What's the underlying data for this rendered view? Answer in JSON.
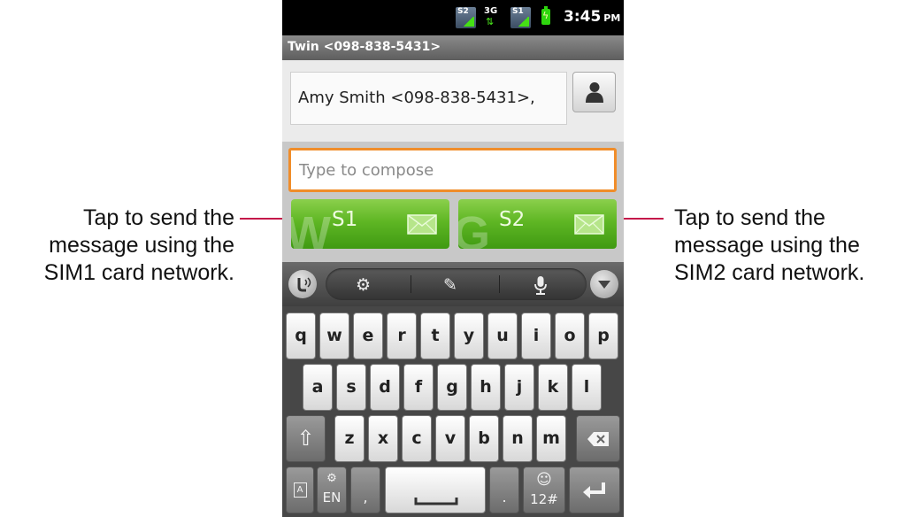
{
  "status_bar": {
    "sim2_label": "S2",
    "network_label": "3G",
    "sim1_label": "S1",
    "time": "3:45",
    "ampm": "PM",
    "icons": [
      "sim2-signal-icon",
      "3g-data-icon",
      "sim1-signal-icon",
      "battery-charging-icon"
    ]
  },
  "header": {
    "title": "Twin <098-838-5431>"
  },
  "recipient": {
    "value": "Amy Smith <098-838-5431>,"
  },
  "compose": {
    "placeholder": "Type to compose"
  },
  "send_buttons": [
    {
      "network_mark": "W",
      "sim_label": "S1",
      "icon": "envelope-icon"
    },
    {
      "network_mark": "G",
      "sim_label": "S2",
      "icon": "envelope-icon"
    }
  ],
  "keyboard_toolbar": {
    "icons": [
      "voice-input-icon",
      "settings-gear-icon",
      "edit-text-icon",
      "microphone-icon",
      "hide-keyboard-icon"
    ]
  },
  "keyboard": {
    "row1": [
      "q",
      "w",
      "e",
      "r",
      "t",
      "y",
      "u",
      "i",
      "o",
      "p"
    ],
    "row2": [
      "a",
      "s",
      "d",
      "f",
      "g",
      "h",
      "j",
      "k",
      "l"
    ],
    "row3": [
      "z",
      "x",
      "c",
      "v",
      "b",
      "n",
      "m"
    ],
    "lang_label": "EN",
    "comma": ",",
    "period": ".",
    "symbols_label": "12#"
  },
  "annotations": {
    "left": [
      "Tap to send the",
      "message using the",
      "SIM1 card network."
    ],
    "right": [
      "Tap to send the",
      "message using the",
      "SIM2 card network."
    ]
  },
  "colors": {
    "leader_line": "#c4164a",
    "send_green": "#5fb624",
    "compose_focus": "#f08d2a"
  }
}
